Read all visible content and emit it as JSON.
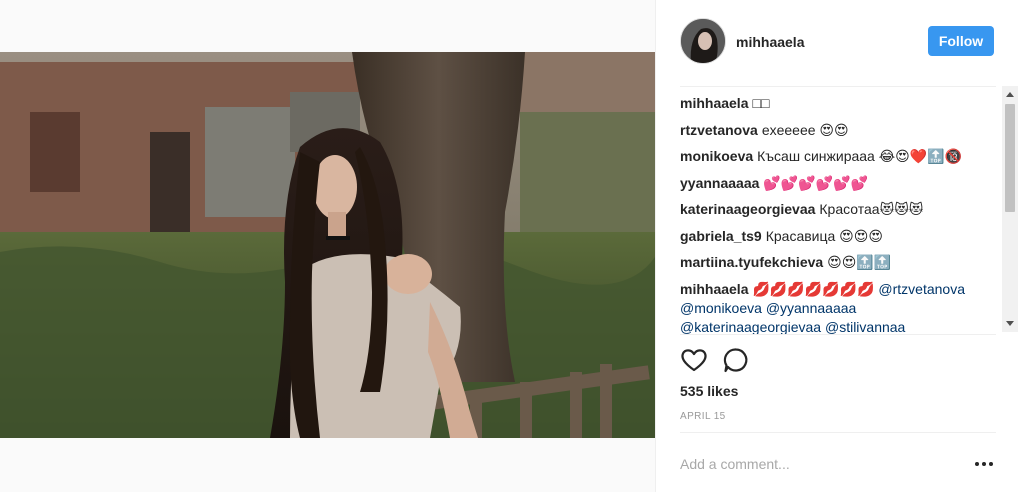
{
  "post": {
    "author": "mihhaaela",
    "follow_label": "Follow",
    "likes": "535 likes",
    "date": "APRIL 15",
    "add_comment_placeholder": "Add a comment..."
  },
  "comments": [
    {
      "user": "mihhaaela",
      "text": "□□"
    },
    {
      "user": "rtzvetanova",
      "text": "exeeeee 😍😍"
    },
    {
      "user": "monikoeva",
      "text": "Късаш синжирааа 😂😍❤️🔝🔞"
    },
    {
      "user": "yyannaaaaa",
      "text": "💕💕💕💕💕💕"
    },
    {
      "user": "katerinaageorgievaa",
      "text": "Красотаа😻😻😻"
    },
    {
      "user": "gabriela_ts9",
      "text": "Красавица 😍😍😍"
    },
    {
      "user": "martiina.tyufekchieva",
      "text": "😍😍🔝🔝"
    }
  ],
  "last_comment": {
    "user": "mihhaaela",
    "text": "💋💋💋💋💋💋💋",
    "mentions": [
      "@rtzvetanova",
      "@monikoeva",
      "@yyannaaaaa",
      "@katerinaageorgievaa",
      "@stilivannaa"
    ]
  },
  "colors": {
    "follow_button": "#3897f0",
    "mention": "#003569",
    "username": "#262626",
    "date": "#999999"
  },
  "icons": [
    "heart-icon",
    "comment-icon",
    "more-options-icon"
  ]
}
